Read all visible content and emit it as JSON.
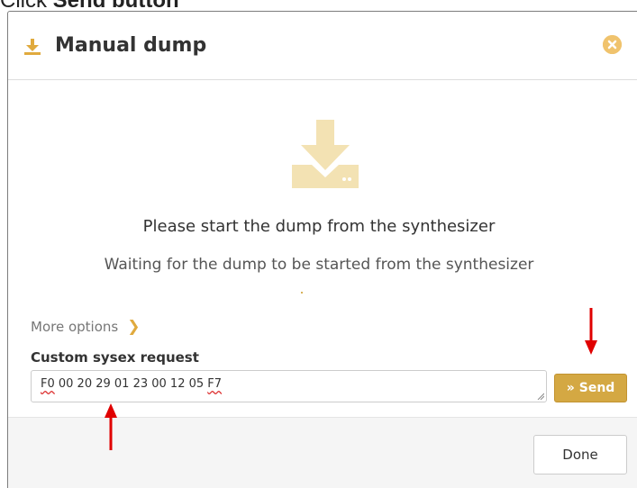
{
  "caption": {
    "prefix": "Click",
    "bold": "Send button"
  },
  "modal": {
    "title": "Manual dump",
    "title_icon": "download-icon",
    "close_icon": "close-circle-icon",
    "status_icon": "download-tray-icon",
    "heading": "Please start the dump from the synthesizer",
    "subtext": "Waiting for the dump to be started from the synthesizer",
    "more_options_label": "More options",
    "more_options_icon": "chevron-right-icon",
    "sysex_label": "Custom sysex request",
    "sysex_value_parts": [
      "F0",
      " 00 20 29 01 23 00 12 05 ",
      "F7"
    ],
    "send_label": "Send",
    "send_icon": "double-chevron-right-icon",
    "done_label": "Done"
  },
  "colors": {
    "accent": "#d4a843",
    "icon_light": "#f3e2b3",
    "annotation_arrow": "#e00000"
  }
}
